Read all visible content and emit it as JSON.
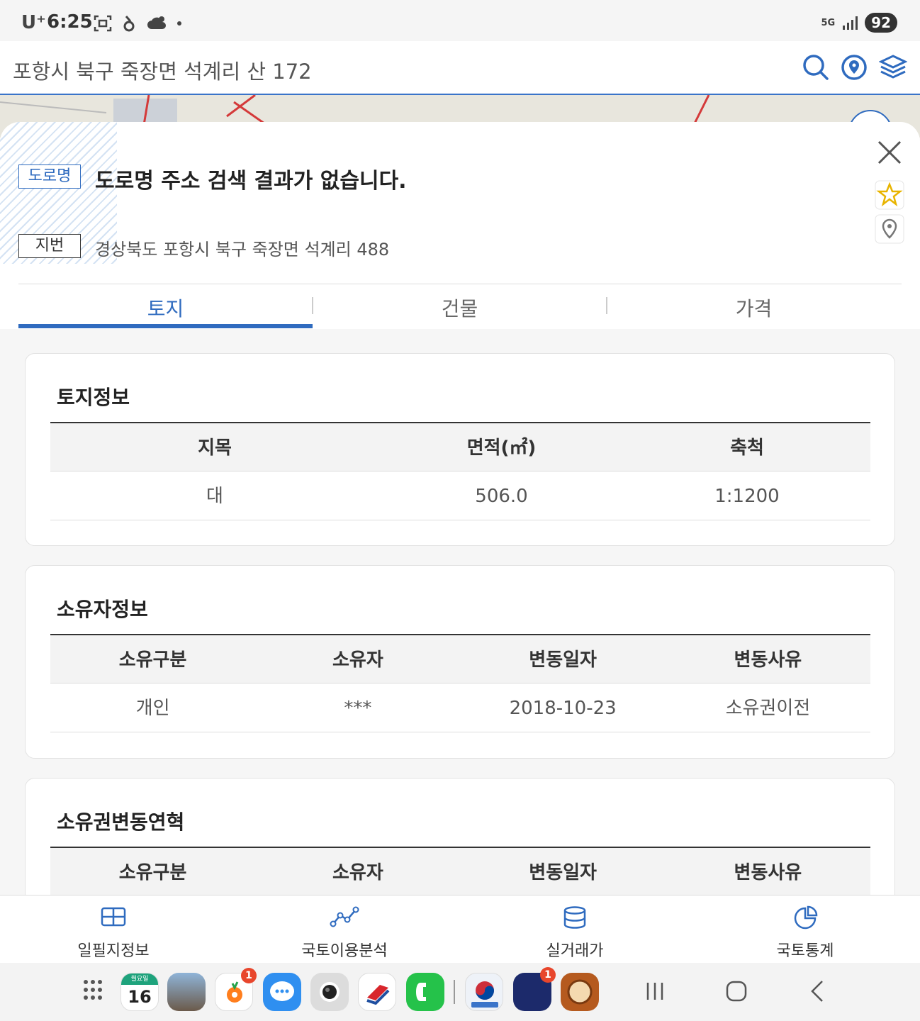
{
  "status_bar": {
    "carrier": "U⁺",
    "time": "6:25",
    "network": "5G",
    "battery": "92"
  },
  "header": {
    "search_text": "포항시 북구 죽장면 석계리 산 172",
    "icons": [
      "search-icon",
      "location-target-icon",
      "layers-icon"
    ]
  },
  "address": {
    "road_tag": "도로명",
    "road_message": "도로명 주소 검색 결과가 없습니다.",
    "jibun_tag": "지번",
    "jibun_address": "경상북도 포항시 북구 죽장면 석계리 488"
  },
  "tabs": [
    {
      "label": "토지",
      "active": true
    },
    {
      "label": "건물",
      "active": false
    },
    {
      "label": "가격",
      "active": false
    }
  ],
  "land_info": {
    "title": "토지정보",
    "headers": [
      "지목",
      "면적(㎡)",
      "축척"
    ],
    "row": [
      "대",
      "506.0",
      "1:1200"
    ]
  },
  "owner_info": {
    "title": "소유자정보",
    "headers": [
      "소유구분",
      "소유자",
      "변동일자",
      "변동사유"
    ],
    "row": [
      "개인",
      "***",
      "2018-10-23",
      "소유권이전"
    ]
  },
  "ownership_history": {
    "title": "소유권변동연혁",
    "headers": [
      "소유구분",
      "소유자",
      "변동일자",
      "변동사유"
    ]
  },
  "bottom_nav": [
    {
      "label": "일필지정보",
      "icon": "grid-map-icon"
    },
    {
      "label": "국토이용분석",
      "icon": "line-chart-icon"
    },
    {
      "label": "실거래가",
      "icon": "database-icon"
    },
    {
      "label": "국토통계",
      "icon": "pie-chart-icon"
    }
  ],
  "dock": {
    "calendar_day_label": "월요일",
    "calendar_date": "16",
    "badge_count_1": "1",
    "badge_count_2": "1"
  },
  "colors": {
    "accent": "#2f6bbf",
    "badge": "#e8462c"
  }
}
